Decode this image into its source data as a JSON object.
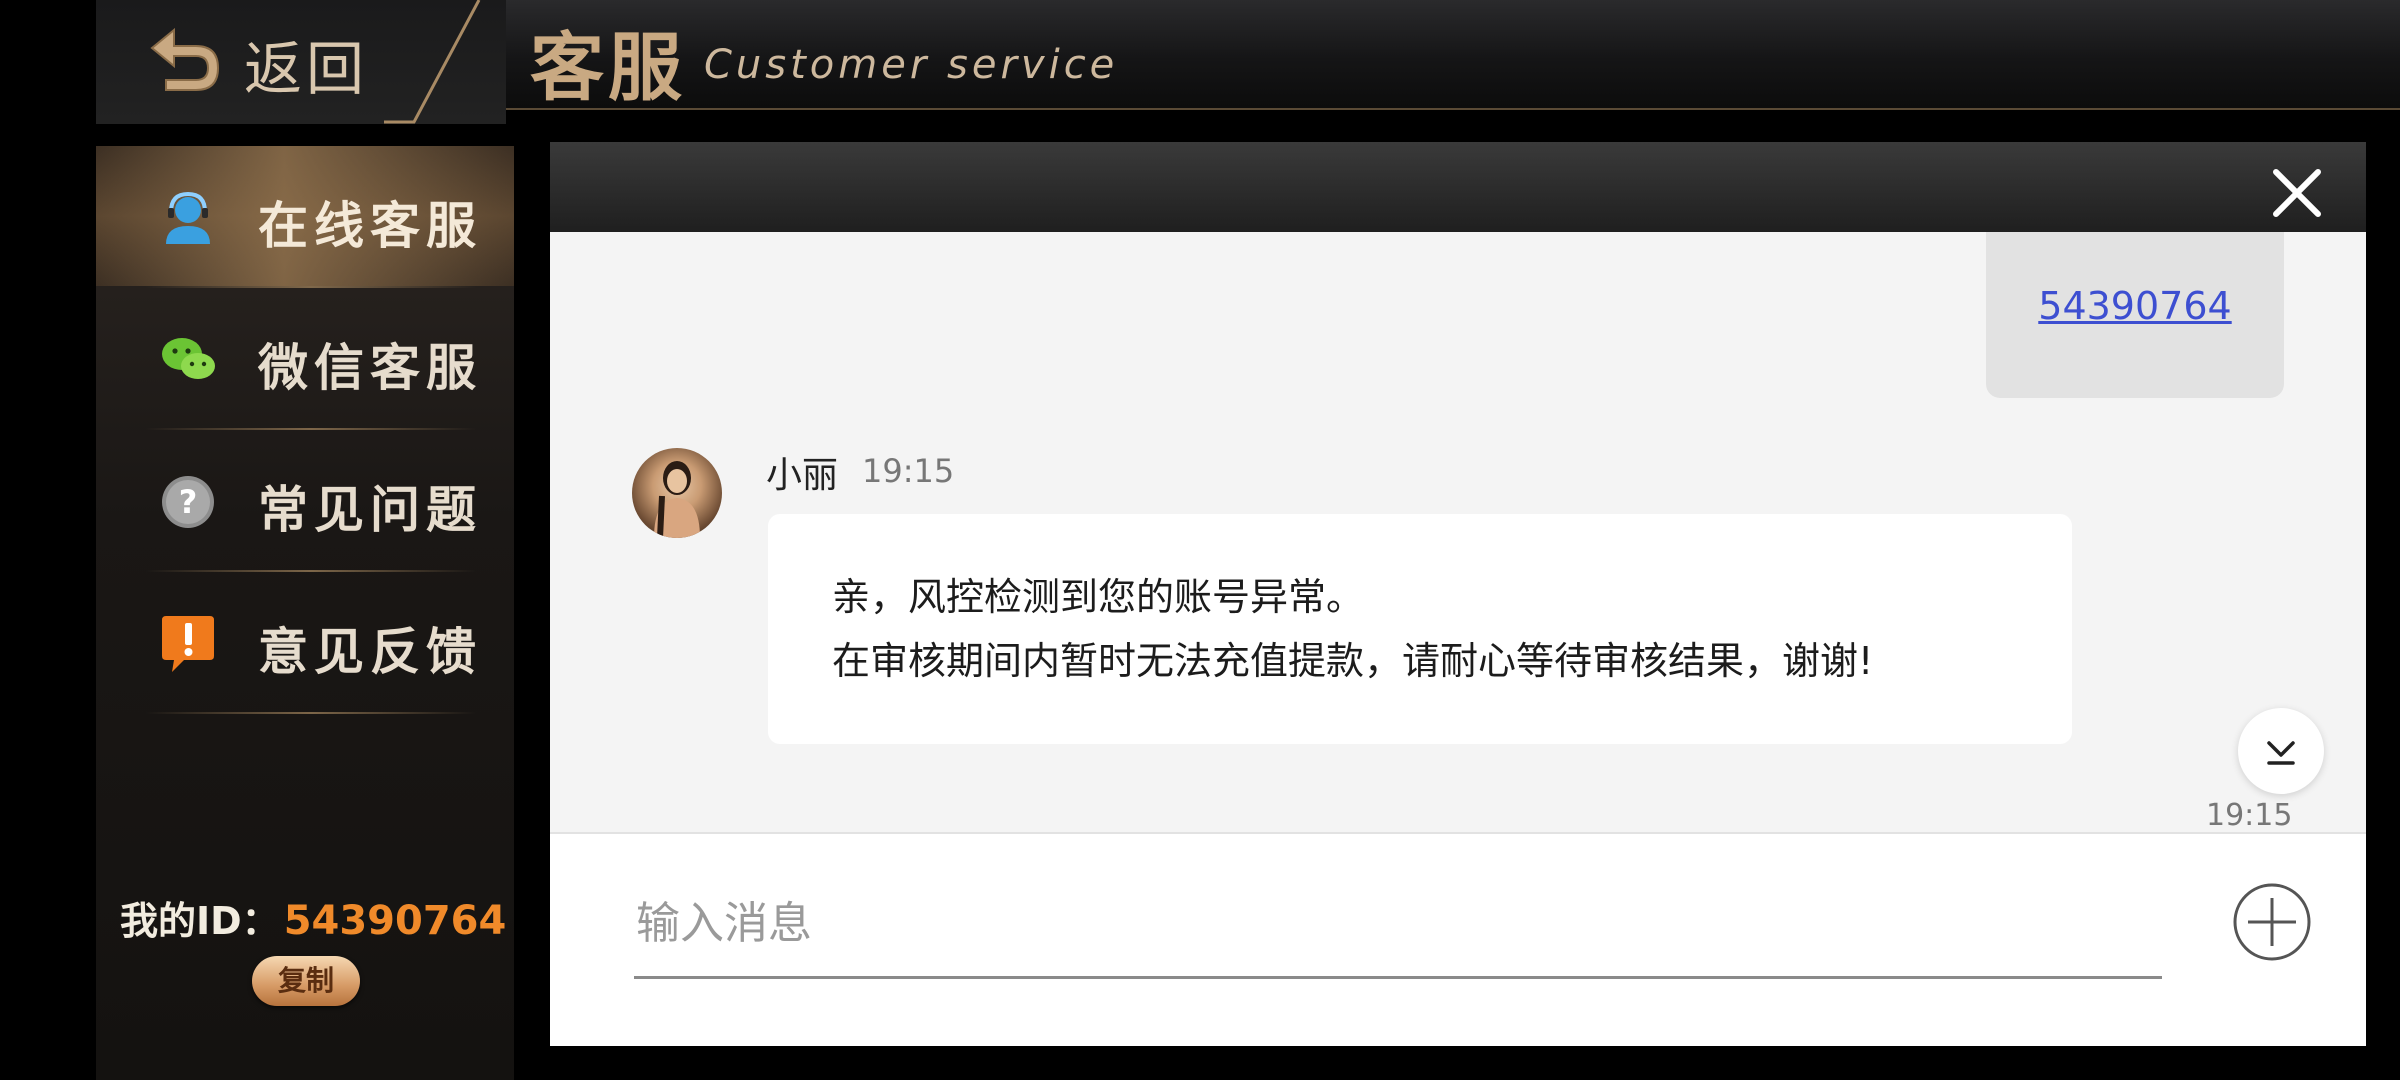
{
  "header": {
    "back_label": "返回",
    "title": "客服",
    "subtitle": "Customer service"
  },
  "sidebar": {
    "items": [
      {
        "label": "在线客服",
        "icon": "headset-agent-icon",
        "active": true
      },
      {
        "label": "微信客服",
        "icon": "wechat-icon",
        "active": false
      },
      {
        "label": "常见问题",
        "icon": "question-icon",
        "active": false
      },
      {
        "label": "意见反馈",
        "icon": "feedback-exclamation-icon",
        "active": false
      }
    ],
    "my_id_label": "我的ID：",
    "my_id_value": "54390764",
    "copy_label": "复制"
  },
  "chat": {
    "sent_message": "54390764",
    "agent": {
      "name": "小丽",
      "time": "19:15"
    },
    "received_lines": [
      "亲，风控检测到您的账号异常。",
      "在审核期间内暂时无法充值提款，请耐心等待审核结果，谢谢!"
    ],
    "bottom_time": "19:15",
    "input_placeholder": "输入消息"
  },
  "colors": {
    "accent_gold": "#c9a982",
    "id_orange": "#f08a2a",
    "link_blue": "#3d4fd1"
  }
}
